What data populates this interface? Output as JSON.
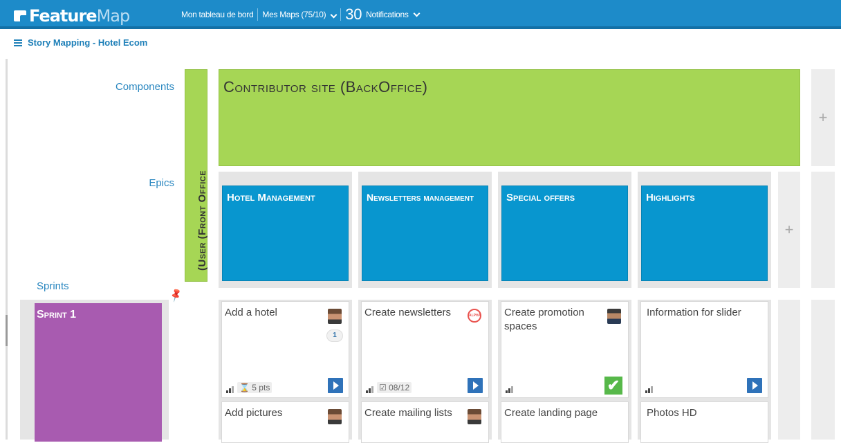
{
  "app": {
    "logo_main": "Feature",
    "logo_accent": "Map"
  },
  "nav": {
    "dashboard": "Mon tableau de bord",
    "maps": "Mes Maps (75/10)",
    "notif_count": "30",
    "notifications": "Notifications"
  },
  "breadcrumb": {
    "title": "Story Mapping - Hotel Ecom"
  },
  "rows": {
    "components": "Components",
    "epics": "Epics",
    "sprints": "Sprints"
  },
  "side_component": "(User (Front Office",
  "component": {
    "title": "Contributor site (BackOffice)"
  },
  "add_symbol": "+",
  "epics": [
    {
      "title": "Hotel Management"
    },
    {
      "title": "Newsletters management"
    },
    {
      "title": "Special offers"
    },
    {
      "title": "Highlights"
    }
  ],
  "sprint": {
    "title": "Sprint 1"
  },
  "stories_row1": [
    {
      "title": "Add a hotel",
      "comments": "1",
      "points": "5 pts"
    },
    {
      "title": "Create newsletters",
      "badge": "ALPHA",
      "date": "08/12"
    },
    {
      "title": "Create promotion spaces"
    },
    {
      "title": "Information for slider"
    }
  ],
  "stories_row2": [
    {
      "title": "Add pictures"
    },
    {
      "title": "Create mailing lists"
    },
    {
      "title": "Create landing page"
    },
    {
      "title": "Photos HD"
    }
  ],
  "icons": {
    "hourglass": "⌛",
    "calendar": "☑",
    "check": "✔",
    "pin": "📌"
  },
  "colors": {
    "topbar": "#1d8bc9",
    "component_green": "#a6d655",
    "epic_blue": "#0896cf",
    "sprint_purple": "#a85bb0",
    "flag_blue": "#2f72b9",
    "done_green": "#57b84a"
  }
}
